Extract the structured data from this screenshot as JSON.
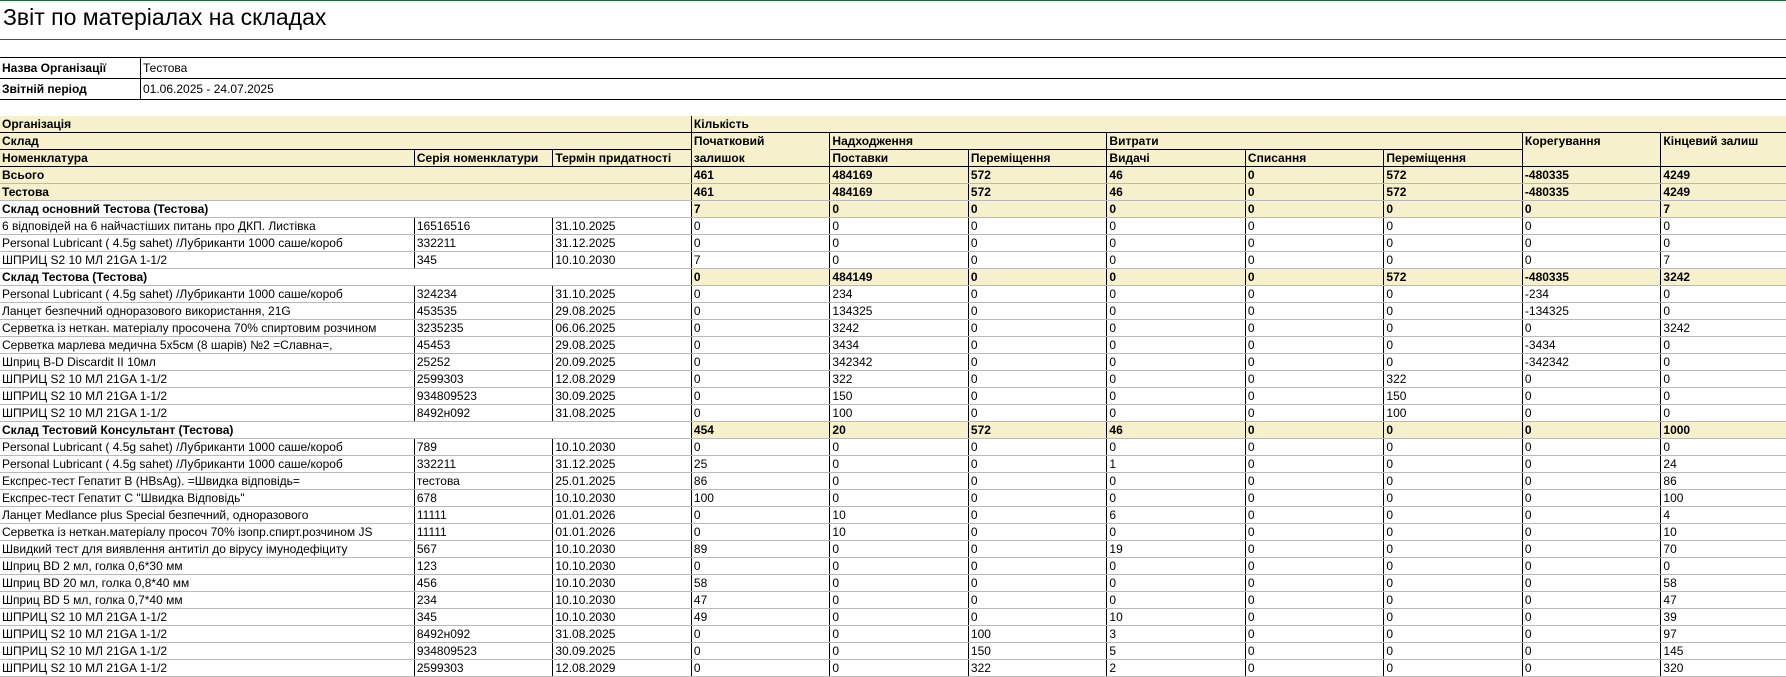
{
  "report": {
    "title": "Звіт по матеріалах на складах",
    "params": [
      {
        "label": "Назва Організації",
        "value": "Тестова"
      },
      {
        "label": "Звітній період",
        "value": "01.06.2025 - 24.07.2025"
      }
    ]
  },
  "headers": {
    "organization": "Організація",
    "quantity": "Кількість",
    "warehouse": "Склад",
    "opening_1": "Початковий",
    "opening_2": "залишок",
    "receipts": "Надходження",
    "expenses": "Витрати",
    "adjustment": "Корегування",
    "closing": "Кінцевий залиш",
    "nomenclature": "Номенклатура",
    "series": "Серія номенклатури",
    "expiry": "Термін придатності",
    "supplies": "Поставки",
    "transfers_in": "Переміщення",
    "issues": "Видачі",
    "writeoffs": "Списання",
    "transfers_out": "Переміщення"
  },
  "rows": [
    {
      "type": "total",
      "name": "Всього",
      "series": "",
      "expiry": "",
      "v": [
        "461",
        "484169",
        "572",
        "46",
        "0",
        "572",
        "-480335",
        "4249"
      ]
    },
    {
      "type": "org",
      "name": "Тестова",
      "series": "",
      "expiry": "",
      "v": [
        "461",
        "484169",
        "572",
        "46",
        "0",
        "572",
        "-480335",
        "4249"
      ]
    },
    {
      "type": "group",
      "name": "Склад основний Тестова (Тестова)",
      "series": "",
      "expiry": "",
      "v": [
        "7",
        "0",
        "0",
        "0",
        "0",
        "0",
        "0",
        "7"
      ]
    },
    {
      "type": "item",
      "name": "6 відповідей на 6 найчастіших питань про ДКП. Листівка",
      "series": "16516516",
      "expiry": "31.10.2025",
      "v": [
        "0",
        "0",
        "0",
        "0",
        "0",
        "0",
        "0",
        "0"
      ]
    },
    {
      "type": "item",
      "name": "Personal Lubricant ( 4.5g sahet) /Лубриканти 1000 саше/короб",
      "series": "332211",
      "expiry": "31.12.2025",
      "v": [
        "0",
        "0",
        "0",
        "0",
        "0",
        "0",
        "0",
        "0"
      ]
    },
    {
      "type": "item",
      "name": "ШПРИЦ S2 10 МЛ 21GA 1-1/2",
      "series": "345",
      "expiry": "10.10.2030",
      "v": [
        "7",
        "0",
        "0",
        "0",
        "0",
        "0",
        "0",
        "7"
      ]
    },
    {
      "type": "group",
      "name": "Склад Тестова (Тестова)",
      "series": "",
      "expiry": "",
      "v": [
        "0",
        "484149",
        "0",
        "0",
        "0",
        "572",
        "-480335",
        "3242"
      ]
    },
    {
      "type": "item",
      "name": "Personal Lubricant ( 4.5g sahet) /Лубриканти 1000 саше/короб",
      "series": "324234",
      "expiry": "31.10.2025",
      "v": [
        "0",
        "234",
        "0",
        "0",
        "0",
        "0",
        "-234",
        "0"
      ]
    },
    {
      "type": "item",
      "name": "Ланцет безпечний одноразового використання, 21G",
      "series": "453535",
      "expiry": "29.08.2025",
      "v": [
        "0",
        "134325",
        "0",
        "0",
        "0",
        "0",
        "-134325",
        "0"
      ]
    },
    {
      "type": "item",
      "name": "Серветка із неткан. матеріалу просочена 70% спиртовим розчином",
      "series": "3235235",
      "expiry": "06.06.2025",
      "v": [
        "0",
        "3242",
        "0",
        "0",
        "0",
        "0",
        "0",
        "3242"
      ]
    },
    {
      "type": "item",
      "name": "Серветка марлева медична 5х5см (8 шарів) №2 =Славна=,",
      "series": "45453",
      "expiry": "29.08.2025",
      "v": [
        "0",
        "3434",
        "0",
        "0",
        "0",
        "0",
        "-3434",
        "0"
      ]
    },
    {
      "type": "item",
      "name": "Шприц B-D Discardit II 10мл",
      "series": "25252",
      "expiry": "20.09.2025",
      "v": [
        "0",
        "342342",
        "0",
        "0",
        "0",
        "0",
        "-342342",
        "0"
      ]
    },
    {
      "type": "item",
      "name": "ШПРИЦ S2 10 МЛ 21GA 1-1/2",
      "series": "2599303",
      "expiry": "12.08.2029",
      "v": [
        "0",
        "322",
        "0",
        "0",
        "0",
        "322",
        "0",
        "0"
      ]
    },
    {
      "type": "item",
      "name": "ШПРИЦ S2 10 МЛ 21GA 1-1/2",
      "series": "934809523",
      "expiry": "30.09.2025",
      "v": [
        "0",
        "150",
        "0",
        "0",
        "0",
        "150",
        "0",
        "0"
      ]
    },
    {
      "type": "item",
      "name": "ШПРИЦ S2 10 МЛ 21GA 1-1/2",
      "series": "8492н092",
      "expiry": "31.08.2025",
      "v": [
        "0",
        "100",
        "0",
        "0",
        "0",
        "100",
        "0",
        "0"
      ]
    },
    {
      "type": "group",
      "name": "Склад Тестовий Консультант  (Тестова)",
      "series": "",
      "expiry": "",
      "v": [
        "454",
        "20",
        "572",
        "46",
        "0",
        "0",
        "0",
        "1000"
      ]
    },
    {
      "type": "item",
      "name": "Personal Lubricant ( 4.5g sahet) /Лубриканти 1000 саше/короб",
      "series": "789",
      "expiry": "10.10.2030",
      "v": [
        "0",
        "0",
        "0",
        "0",
        "0",
        "0",
        "0",
        "0"
      ]
    },
    {
      "type": "item",
      "name": "Personal Lubricant ( 4.5g sahet) /Лубриканти 1000 саше/короб",
      "series": "332211",
      "expiry": "31.12.2025",
      "v": [
        "25",
        "0",
        "0",
        "1",
        "0",
        "0",
        "0",
        "24"
      ]
    },
    {
      "type": "item",
      "name": "Експрес-тест Гепатит B (HBsAg). =Швидка відповідь=",
      "series": "тестова",
      "expiry": "25.01.2025",
      "v": [
        "86",
        "0",
        "0",
        "0",
        "0",
        "0",
        "0",
        "86"
      ]
    },
    {
      "type": "item",
      "name": "Експрес-тест Гепатит С \"Швидка Відповідь\"",
      "series": "678",
      "expiry": "10.10.2030",
      "v": [
        "100",
        "0",
        "0",
        "0",
        "0",
        "0",
        "0",
        "100"
      ]
    },
    {
      "type": "item",
      "name": "Ланцет Medlance plus Special безпечний, одноразового",
      "series": "11111",
      "expiry": "01.01.2026",
      "v": [
        "0",
        "10",
        "0",
        "6",
        "0",
        "0",
        "0",
        "4"
      ]
    },
    {
      "type": "item",
      "name": "Серветка із неткан.матеріалу просоч 70% ізопр.спирт.розчином JS",
      "series": "11111",
      "expiry": "01.01.2026",
      "v": [
        "0",
        "10",
        "0",
        "0",
        "0",
        "0",
        "0",
        "10"
      ]
    },
    {
      "type": "item",
      "name": "Швидкий тест для виявлення антитіл до вірусу імунодефіциту",
      "series": "567",
      "expiry": "10.10.2030",
      "v": [
        "89",
        "0",
        "0",
        "19",
        "0",
        "0",
        "0",
        "70"
      ]
    },
    {
      "type": "item",
      "name": "Шприц BD 2 мл, голка 0,6*30 мм",
      "series": "123",
      "expiry": "10.10.2030",
      "v": [
        "0",
        "0",
        "0",
        "0",
        "0",
        "0",
        "0",
        "0"
      ]
    },
    {
      "type": "item",
      "name": "Шприц BD 20 мл, голка 0,8*40 мм",
      "series": "456",
      "expiry": "10.10.2030",
      "v": [
        "58",
        "0",
        "0",
        "0",
        "0",
        "0",
        "0",
        "58"
      ]
    },
    {
      "type": "item",
      "name": "Шприц BD 5 мл, голка 0,7*40 мм",
      "series": "234",
      "expiry": "10.10.2030",
      "v": [
        "47",
        "0",
        "0",
        "0",
        "0",
        "0",
        "0",
        "47"
      ]
    },
    {
      "type": "item",
      "name": "ШПРИЦ S2 10 МЛ 21GA 1-1/2",
      "series": "345",
      "expiry": "10.10.2030",
      "v": [
        "49",
        "0",
        "0",
        "10",
        "0",
        "0",
        "0",
        "39"
      ]
    },
    {
      "type": "item",
      "name": "ШПРИЦ S2 10 МЛ 21GA 1-1/2",
      "series": "8492н092",
      "expiry": "31.08.2025",
      "v": [
        "0",
        "0",
        "100",
        "3",
        "0",
        "0",
        "0",
        "97"
      ]
    },
    {
      "type": "item",
      "name": "ШПРИЦ S2 10 МЛ 21GA 1-1/2",
      "series": "934809523",
      "expiry": "30.09.2025",
      "v": [
        "0",
        "0",
        "150",
        "5",
        "0",
        "0",
        "0",
        "145"
      ]
    },
    {
      "type": "item",
      "name": "ШПРИЦ S2 10 МЛ 21GA 1-1/2",
      "series": "2599303",
      "expiry": "12.08.2029",
      "v": [
        "0",
        "0",
        "322",
        "2",
        "0",
        "0",
        "0",
        "320"
      ]
    }
  ]
}
